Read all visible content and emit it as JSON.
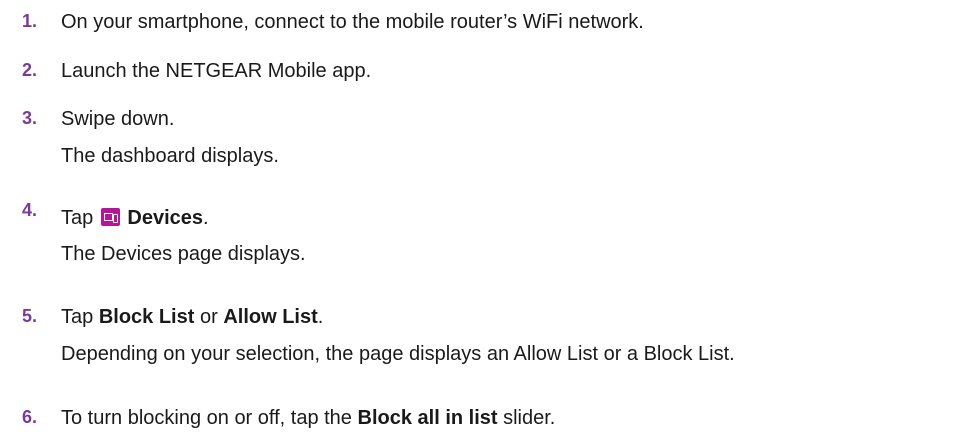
{
  "steps": [
    {
      "number": "1.",
      "text": "On your smartphone, connect to the mobile router’s WiFi network."
    },
    {
      "number": "2.",
      "text": "Launch the NETGEAR Mobile app."
    },
    {
      "number": "3.",
      "text": "Swipe down.",
      "result": "The dashboard displays."
    },
    {
      "number": "4.",
      "prefix": "Tap",
      "bold": "Devices",
      "suffix": ".",
      "icon": "devices-icon",
      "result": "The Devices page displays."
    },
    {
      "number": "5.",
      "prefix": "Tap",
      "bold1": "Block List",
      "middle": "or",
      "bold2": "Allow List",
      "suffix": ".",
      "result": "Depending on your selection, the page displays an Allow List or a Block List."
    },
    {
      "number": "6.",
      "prefix": "To turn blocking on or off, tap the",
      "bold": "Block all in list",
      "suffix": "slider."
    }
  ],
  "colors": {
    "step_number": "#7b3a96",
    "icon": "#b4169a",
    "text": "#1a1a1a"
  }
}
